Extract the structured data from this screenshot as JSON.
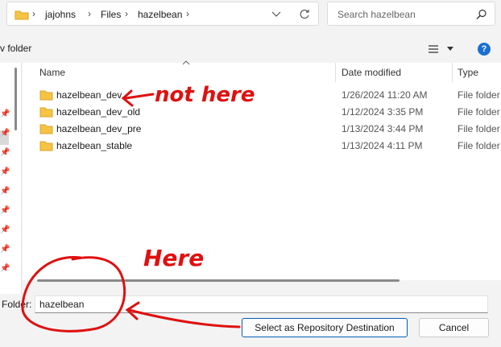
{
  "address_bar": {
    "breadcrumbs": [
      "jajohns",
      "Files",
      "hazelbean"
    ],
    "separator": "›"
  },
  "search": {
    "placeholder": "Search hazelbean"
  },
  "toolbar": {
    "new_folder_label": "v folder",
    "help_label": "?"
  },
  "columns": {
    "name": "Name",
    "date_modified": "Date modified",
    "type": "Type"
  },
  "files": [
    {
      "name": "hazelbean_dev",
      "date": "1/26/2024 11:20 AM",
      "type": "File folder"
    },
    {
      "name": "hazelbean_dev_old",
      "date": "1/12/2024 3:35 PM",
      "type": "File folder"
    },
    {
      "name": "hazelbean_dev_pre",
      "date": "1/13/2024 3:44 PM",
      "type": "File folder"
    },
    {
      "name": "hazelbean_stable",
      "date": "1/13/2024 4:11 PM",
      "type": "File folder"
    }
  ],
  "folder_field": {
    "label": "Folder:",
    "value": "hazelbean"
  },
  "buttons": {
    "select_label": "Select as Repository Destination",
    "cancel_label": "Cancel"
  },
  "annotations": {
    "not_here": "not here",
    "here": "Here",
    "color": "#e01010"
  },
  "icons": [
    "folder-icon",
    "chevron-down-icon",
    "refresh-icon",
    "search-icon",
    "view-menu-icon",
    "help-icon",
    "pin-icon",
    "sort-arrow-icon"
  ]
}
